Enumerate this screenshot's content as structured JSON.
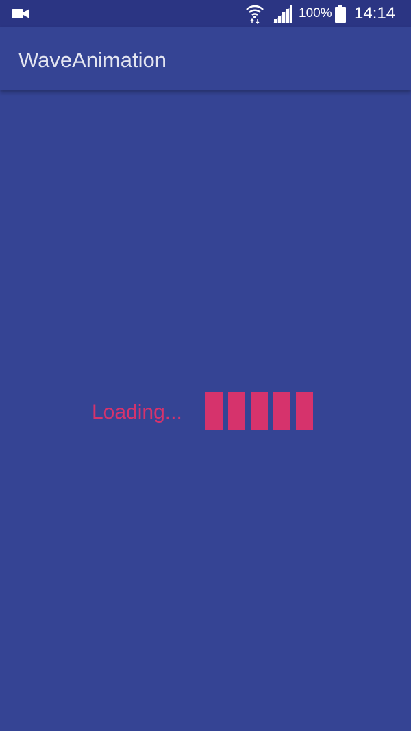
{
  "status_bar": {
    "battery_percent": "100%",
    "time": "14:14",
    "icons": [
      "video-camera-icon",
      "wifi-icon",
      "signal-icon",
      "battery-icon"
    ]
  },
  "app_bar": {
    "title": "WaveAnimation"
  },
  "loader": {
    "text": "Loading...",
    "bar_count": 5
  },
  "colors": {
    "status_bar": "#2b3583",
    "primary": "#354494",
    "accent": "#d6336c",
    "title_text": "#e4e6f1"
  }
}
